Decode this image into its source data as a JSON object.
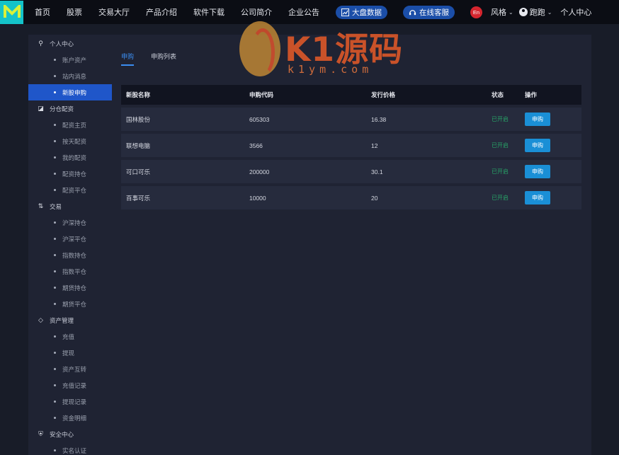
{
  "topbar": {
    "logo_letter": "M",
    "nav": [
      {
        "label": "首页"
      },
      {
        "label": "股票"
      },
      {
        "label": "交易大厅"
      },
      {
        "label": "产品介绍"
      },
      {
        "label": "软件下载"
      },
      {
        "label": "公司简介"
      },
      {
        "label": "企业公告"
      }
    ],
    "big_data_label": "大盘数据",
    "service_label": "在线客服",
    "lang_label": "En",
    "style_label": "风格",
    "username": "跑跑",
    "personal_center": "个人中心",
    "colors": {
      "background": "#0b0d14",
      "pill": "#1b4ea8",
      "lang": "#d6262f",
      "logo": "#14c3c9"
    }
  },
  "watermark": {
    "brand": "K1源码",
    "subtitle": "k1ym.com"
  },
  "sidebar": {
    "groups": [
      {
        "label": "个人中心",
        "icon": "user-icon",
        "items": [
          {
            "label": "账户资产"
          },
          {
            "label": "站内消息"
          },
          {
            "label": "新股申购",
            "active": true
          }
        ]
      },
      {
        "label": "分仓配资",
        "icon": "chart-circle-icon",
        "items": [
          {
            "label": "配资主页"
          },
          {
            "label": "按天配资"
          },
          {
            "label": "我的配资"
          },
          {
            "label": "配资持仓"
          },
          {
            "label": "配资平仓"
          }
        ]
      },
      {
        "label": "交易",
        "icon": "exchange-icon",
        "items": [
          {
            "label": "沪深持仓"
          },
          {
            "label": "沪深平仓"
          },
          {
            "label": "指数持仓"
          },
          {
            "label": "指数平仓"
          },
          {
            "label": "期货持仓"
          },
          {
            "label": "期货平仓"
          }
        ]
      },
      {
        "label": "资产管理",
        "icon": "layers-icon",
        "items": [
          {
            "label": "充值"
          },
          {
            "label": "提现"
          },
          {
            "label": "资产互转"
          },
          {
            "label": "充值记录"
          },
          {
            "label": "提现记录"
          },
          {
            "label": "资金明细"
          }
        ]
      },
      {
        "label": "安全中心",
        "icon": "shield-icon",
        "items": [
          {
            "label": "实名认证"
          }
        ]
      }
    ],
    "active_color": "#1f56c9"
  },
  "main": {
    "tabs": [
      {
        "label": "申购",
        "active": true
      },
      {
        "label": "申购列表"
      }
    ],
    "table": {
      "headers": [
        "新股名称",
        "申购代码",
        "发行价格",
        "状态",
        "操作"
      ],
      "rows": [
        {
          "name": "国林股份",
          "code": "605303",
          "price": "16.38",
          "status": "已开启",
          "action": "申购"
        },
        {
          "name": "联想电脑",
          "code": "3566",
          "price": "12",
          "status": "已开启",
          "action": "申购"
        },
        {
          "name": "可口可乐",
          "code": "200000",
          "price": "30.1",
          "status": "已开启",
          "action": "申购"
        },
        {
          "name": "百事可乐",
          "code": "10000",
          "price": "20",
          "status": "已开启",
          "action": "申购"
        }
      ]
    },
    "colors": {
      "tab_active": "#3b8df0",
      "status": "#27a468",
      "button": "#1a8fd6"
    }
  }
}
